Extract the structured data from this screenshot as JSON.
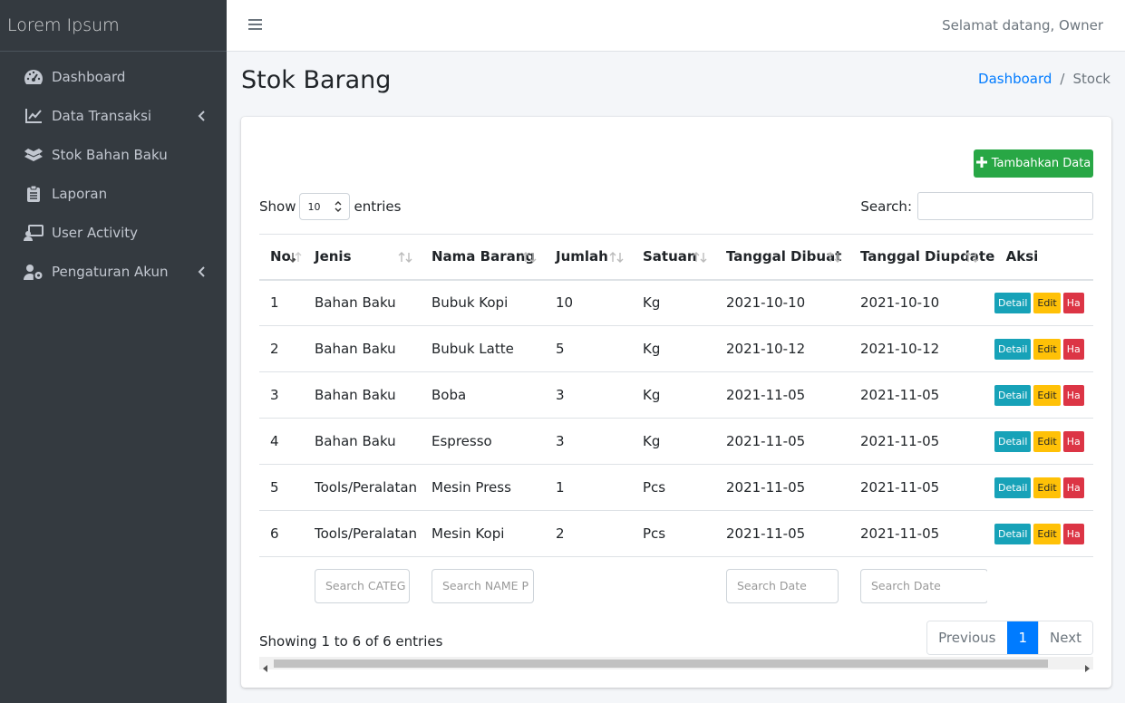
{
  "app": {
    "brand": "Lorem Ipsum"
  },
  "sidebar": {
    "items": [
      {
        "label": "Dashboard",
        "icon": "tachometer-icon"
      },
      {
        "label": "Data Transaksi",
        "icon": "chart-line-icon",
        "has_children": true
      },
      {
        "label": "Stok Bahan Baku",
        "icon": "boxes-icon"
      },
      {
        "label": "Laporan",
        "icon": "clipboard-list-icon"
      },
      {
        "label": "User Activity",
        "icon": "user-monitor-icon"
      },
      {
        "label": "Pengaturan Akun",
        "icon": "user-cog-icon",
        "has_children": true
      }
    ]
  },
  "topbar": {
    "welcome": "Selamat datang, Owner"
  },
  "header": {
    "title": "Stok Barang",
    "breadcrumb": {
      "link": "Dashboard",
      "separator": "/",
      "active": "Stock"
    }
  },
  "toolbar": {
    "add_label": "Tambahkan Data"
  },
  "datatable": {
    "show_label": "Show",
    "entries_label": "entries",
    "length_value": "10",
    "search_label": "Search:",
    "columns": [
      "No.",
      "Jenis",
      "Nama Barang",
      "Jumlah",
      "Satuan",
      "Tanggal Dibuat",
      "Tanggal Diupdate",
      "Aksi"
    ],
    "rows": [
      [
        "1",
        "Bahan Baku",
        "Bubuk Kopi",
        "10",
        "Kg",
        "2021-10-10",
        "2021-10-10"
      ],
      [
        "2",
        "Bahan Baku",
        "Bubuk Latte",
        "5",
        "Kg",
        "2021-10-12",
        "2021-10-12"
      ],
      [
        "3",
        "Bahan Baku",
        "Boba",
        "3",
        "Kg",
        "2021-11-05",
        "2021-11-05"
      ],
      [
        "4",
        "Bahan Baku",
        "Espresso",
        "3",
        "Kg",
        "2021-11-05",
        "2021-11-05"
      ],
      [
        "5",
        "Tools/Peralatan",
        "Mesin Press",
        "1",
        "Pcs",
        "2021-11-05",
        "2021-11-05"
      ],
      [
        "6",
        "Tools/Peralatan",
        "Mesin Kopi",
        "2",
        "Pcs",
        "2021-11-05",
        "2021-11-05"
      ]
    ],
    "actions": {
      "detail": "Detail",
      "edit": "Edit",
      "delete": "Ha"
    },
    "filters": {
      "category": "Search CATEG",
      "name": "Search NAME P",
      "created": "Search Date",
      "updated": "Search Date"
    },
    "info": "Showing 1 to 6 of 6 entries",
    "pagination": {
      "previous": "Previous",
      "current": "1",
      "next": "Next"
    }
  },
  "colors": {
    "sidebar_bg": "#343a40",
    "primary": "#007bff",
    "success": "#28a745",
    "info": "#17a2b8",
    "warning": "#ffc107",
    "danger": "#dc3545"
  }
}
